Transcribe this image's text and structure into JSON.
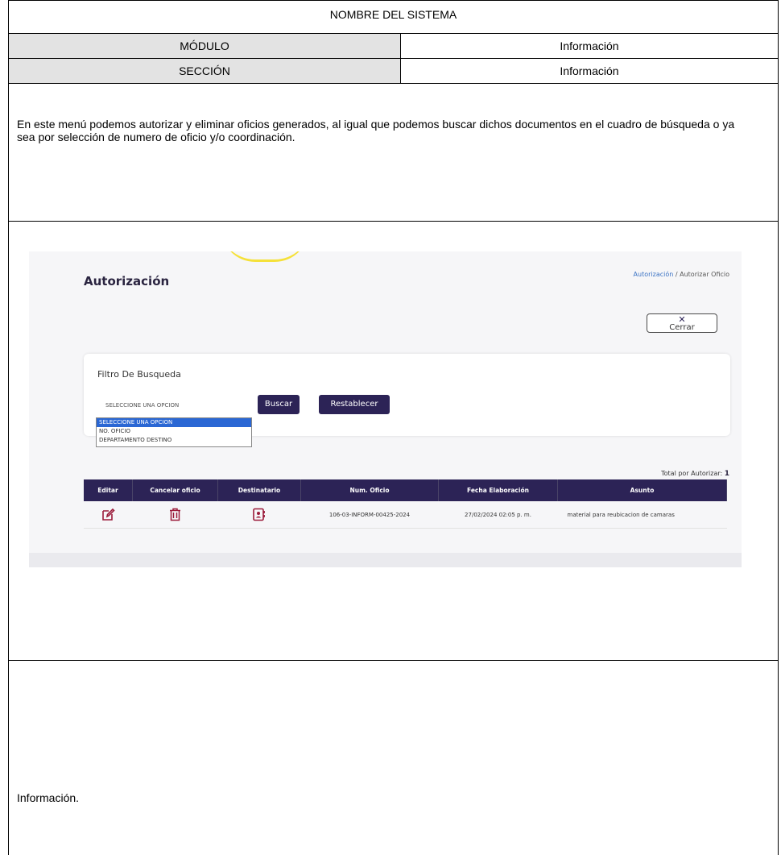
{
  "header": {
    "system_name": "NOMBRE DEL SISTEMA",
    "module_label": "MÓDULO",
    "module_value": "Información",
    "section_label": "SECCIÓN",
    "section_value": "Información"
  },
  "description": "En este menú podemos autorizar y eliminar oficios generados, al igual que podemos buscar dichos documentos en el cuadro de búsqueda o ya sea por selección de numero de oficio y/o coordinación.",
  "screenshot": {
    "page_title": "Autorización",
    "breadcrumb_link": "Autorización",
    "breadcrumb_sep": "/",
    "breadcrumb_current": "Autorizar Oficio",
    "close_label": "Cerrar",
    "filter_title": "Filtro De Busqueda",
    "select_value": "SELECCIONE UNA OPCION",
    "search_button": "Buscar",
    "reset_button": "Restablecer",
    "dropdown_options": [
      "SELECCIONE UNA OPCION",
      "NO. OFICIO",
      "DEPARTAMENTO DESTINO"
    ],
    "total_label": "Total por Autorizar:",
    "total_value": "1",
    "columns": [
      "Editar",
      "Cancelar oficio",
      "Destinatario",
      "Num. Oficio",
      "Fecha Elaboración",
      "Asunto"
    ],
    "rows": [
      {
        "num_oficio": "106-03-INFORM-00425-2024",
        "fecha": "27/02/2024 02:05 p. m.",
        "asunto": "material para reubicacion de camaras"
      }
    ],
    "accent_color": "#2c2356",
    "icon_color": "#9b1b3a"
  },
  "footer_text": "Información."
}
